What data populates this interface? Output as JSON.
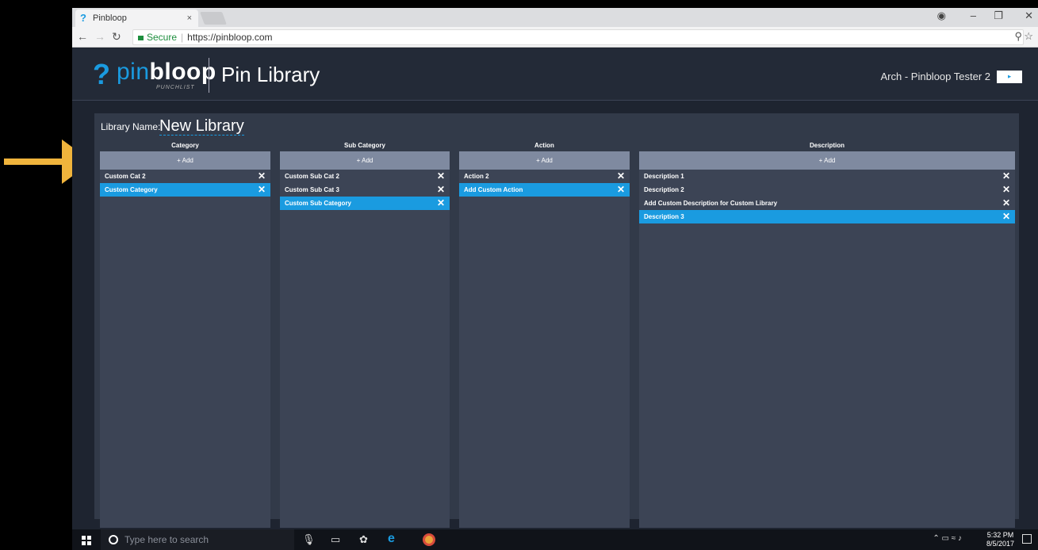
{
  "browser": {
    "tab_title": "Pinbloop",
    "tab_close": "×",
    "secure_label": "Secure",
    "url": "https://pinbloop.com"
  },
  "header": {
    "logo_part1": "pin",
    "logo_part2": "bloop",
    "logo_sub": "PUNCHLIST",
    "page_title": "Pin Library",
    "user_name": "Arch - Pinbloop Tester 2"
  },
  "library": {
    "name_label": "Library Name:",
    "name_value": "New Library"
  },
  "columns": [
    {
      "header": "Category",
      "add_label": "+ Add",
      "items": [
        {
          "label": "Custom Cat 2",
          "selected": false
        },
        {
          "label": "Custom Category",
          "selected": true
        }
      ]
    },
    {
      "header": "Sub Category",
      "add_label": "+ Add",
      "items": [
        {
          "label": "Custom Sub Cat 2",
          "selected": false
        },
        {
          "label": "Custom Sub Cat 3",
          "selected": false
        },
        {
          "label": "Custom Sub Category",
          "selected": true
        }
      ]
    },
    {
      "header": "Action",
      "add_label": "+ Add",
      "items": [
        {
          "label": "Action 2",
          "selected": false
        },
        {
          "label": "Add Custom Action",
          "selected": true
        }
      ]
    },
    {
      "header": "Description",
      "add_label": "+ Add",
      "items": [
        {
          "label": "Description 1",
          "selected": false
        },
        {
          "label": "Description 2",
          "selected": false
        },
        {
          "label": "Add Custom Description for Custom Library",
          "selected": false
        },
        {
          "label": "Description 3",
          "selected": true
        }
      ]
    }
  ],
  "taskbar": {
    "search_placeholder": "Type here to search",
    "time": "5:32 PM",
    "date": "8/5/2017"
  },
  "colors": {
    "accent": "#1a9be0",
    "annotation_arrow": "#f0b43c"
  }
}
